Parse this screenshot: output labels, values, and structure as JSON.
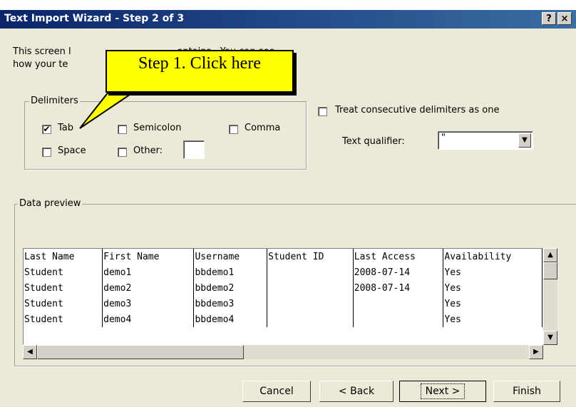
{
  "window": {
    "title": "Text Import Wizard - Step 2 of 3",
    "help_label": "?",
    "close_label": "×"
  },
  "intro": {
    "line1": "This screen l                                    ontains.  You can see",
    "line2": "how your te"
  },
  "callout": {
    "text": "Step 1. Click here"
  },
  "delimiters": {
    "legend": "Delimiters",
    "tab": {
      "label": "Tab",
      "checked": true
    },
    "semicolon": {
      "label": "Semicolon",
      "checked": false
    },
    "comma": {
      "label": "Comma",
      "checked": false
    },
    "space": {
      "label": "Space",
      "checked": false
    },
    "other": {
      "label": "Other:",
      "checked": false,
      "value": ""
    }
  },
  "consecutive": {
    "label": "Treat consecutive delimiters as one",
    "checked": false
  },
  "text_qualifier": {
    "label": "Text qualifier:",
    "value": "\""
  },
  "preview": {
    "legend": "Data preview",
    "rows": [
      [
        "Last Name",
        "First Name",
        "Username",
        "Student ID",
        "Last Access",
        "Availability"
      ],
      [
        "Student",
        "demo1",
        "bbdemo1",
        "",
        "2008-07-14",
        "Yes"
      ],
      [
        "Student",
        "demo2",
        "bbdemo2",
        "",
        "2008-07-14",
        "Yes"
      ],
      [
        "Student",
        "demo3",
        "bbdemo3",
        "",
        "",
        "Yes"
      ],
      [
        "Student",
        "demo4",
        "bbdemo4",
        "",
        "",
        "Yes"
      ]
    ]
  },
  "buttons": {
    "cancel": "Cancel",
    "back": "< Back",
    "next": "Next >",
    "finish": "Finish"
  },
  "icons": {
    "check": "✔",
    "up": "▲",
    "down": "▼",
    "left": "◀",
    "right": "▶"
  }
}
